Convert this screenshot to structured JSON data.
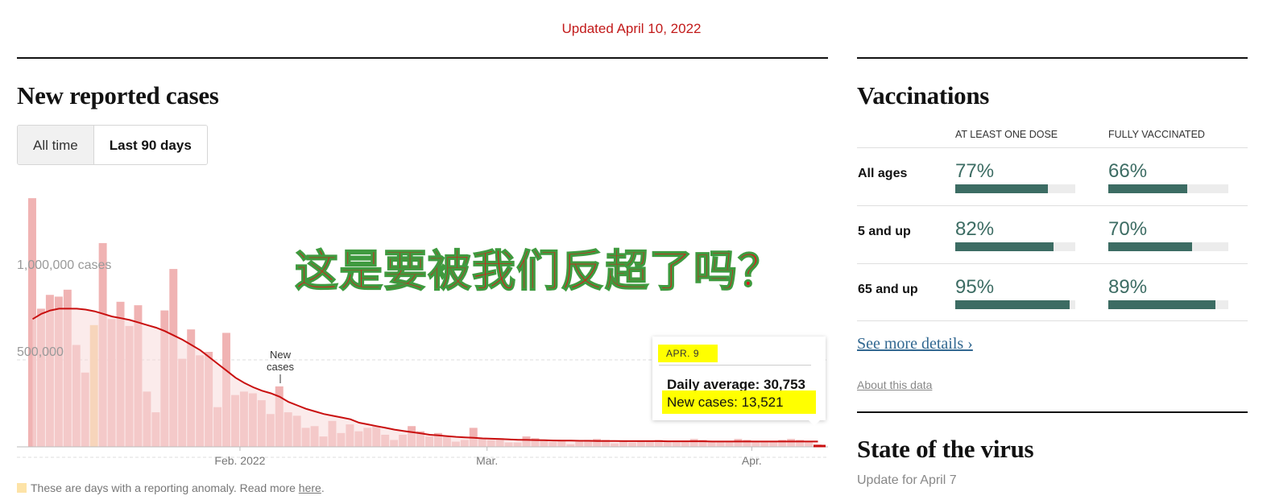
{
  "header": {
    "updated": "Updated April 10, 2022"
  },
  "cases": {
    "title": "New reported cases",
    "toggle": {
      "all_time": "All time",
      "last_90": "Last 90 days"
    },
    "annotation": {
      "line1": "New",
      "line2": "cases"
    },
    "tooltip": {
      "date": "APR. 9",
      "daily_average": "Daily average: 30,753",
      "new_cases": "New cases: 13,521",
      "highlight_color": "#ffff00"
    },
    "anomaly_note": {
      "text": "These are days with a reporting anomaly. Read more ",
      "link": "here",
      "end": "."
    }
  },
  "overlay_text": "这是要被我们反超了吗？",
  "chart_data": {
    "type": "bar",
    "title": "",
    "xlabel": "",
    "ylabel": "",
    "ylim": [
      0,
      1450000
    ],
    "y_ticks": [
      {
        "value": 500000,
        "label": "500,000"
      },
      {
        "value": 1000000,
        "label": "1,000,000 cases"
      }
    ],
    "x_ticks": [
      {
        "day": 24,
        "label": "Feb. 2022"
      },
      {
        "day": 52,
        "label": "Mar."
      },
      {
        "day": 82,
        "label": "Apr."
      }
    ],
    "anomaly_days": [
      7
    ],
    "highlight_day": 89,
    "series": [
      {
        "name": "New cases",
        "color": "#f0b3b3",
        "values": [
          1440000,
          800000,
          880000,
          870000,
          910000,
          590000,
          430000,
          705000,
          1180000,
          740000,
          840000,
          700000,
          820000,
          320000,
          200000,
          790000,
          1030000,
          510000,
          680000,
          530000,
          550000,
          230000,
          660000,
          300000,
          320000,
          310000,
          270000,
          190000,
          350000,
          200000,
          180000,
          110000,
          120000,
          60000,
          150000,
          80000,
          130000,
          90000,
          110000,
          120000,
          70000,
          40000,
          70000,
          120000,
          90000,
          60000,
          80000,
          60000,
          30000,
          40000,
          110000,
          50000,
          40000,
          50000,
          25000,
          25000,
          60000,
          50000,
          40000,
          30000,
          35000,
          15000,
          30000,
          40000,
          45000,
          40000,
          20000,
          35000,
          25000,
          30000,
          30000,
          40000,
          35000,
          30000,
          30000,
          45000,
          40000,
          35000,
          30000,
          35000,
          45000,
          40000,
          30000,
          35000,
          30000,
          40000,
          45000,
          40000,
          35000,
          13521
        ]
      },
      {
        "name": "Daily average",
        "color": "#c90f0f",
        "values": [
          740000,
          770000,
          790000,
          800000,
          800000,
          800000,
          795000,
          785000,
          770000,
          755000,
          745000,
          735000,
          720000,
          705000,
          690000,
          670000,
          645000,
          620000,
          590000,
          560000,
          520000,
          480000,
          440000,
          400000,
          370000,
          345000,
          325000,
          310000,
          290000,
          260000,
          240000,
          220000,
          205000,
          190000,
          180000,
          170000,
          160000,
          140000,
          130000,
          120000,
          110000,
          100000,
          92000,
          85000,
          78000,
          70000,
          66000,
          62000,
          58000,
          55000,
          52000,
          49000,
          47000,
          45000,
          43000,
          41000,
          40000,
          39000,
          38000,
          37000,
          36000,
          36000,
          35000,
          35000,
          34000,
          34000,
          34000,
          33000,
          33000,
          33000,
          33000,
          33000,
          32000,
          32000,
          32000,
          32000,
          32000,
          31000,
          31000,
          31000,
          31000,
          31000,
          31000,
          31000,
          31000,
          31000,
          31000,
          31000,
          31000,
          30753
        ]
      }
    ],
    "band_color": "#f7dada"
  },
  "vaccinations": {
    "title": "Vaccinations",
    "col1": "AT LEAST ONE DOSE",
    "col2": "FULLY VACCINATED",
    "accent": "#3c6c63",
    "rows": [
      {
        "label": "All ages",
        "one": "77%",
        "full": "66%",
        "one_v": 0.77,
        "full_v": 0.66
      },
      {
        "label": "5 and up",
        "one": "82%",
        "full": "70%",
        "one_v": 0.82,
        "full_v": 0.7
      },
      {
        "label": "65 and up",
        "one": "95%",
        "full": "89%",
        "one_v": 0.95,
        "full_v": 0.89
      }
    ],
    "more_link": "See more details ›",
    "about_link": "About this data"
  },
  "state": {
    "title": "State of the virus",
    "subtitle": "Update for April 7"
  }
}
